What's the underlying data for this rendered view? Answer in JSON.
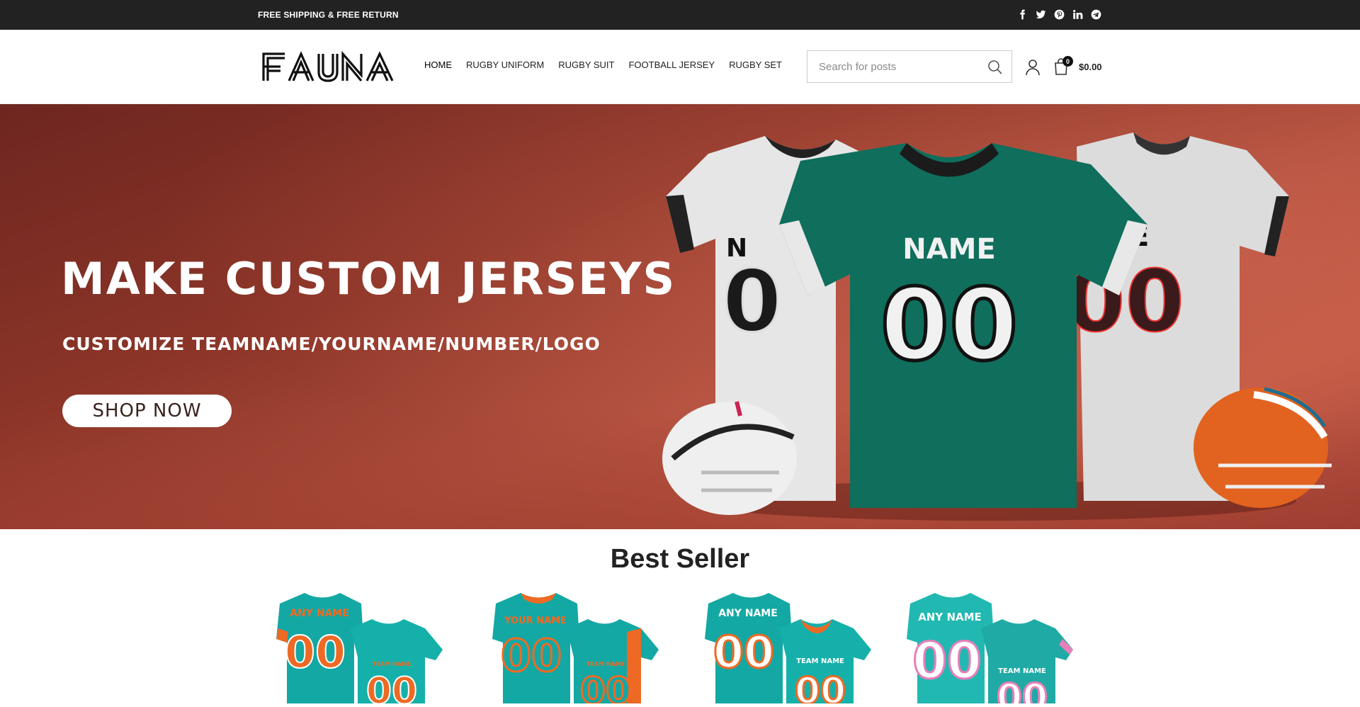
{
  "topbar": {
    "promo": "FREE SHIPPING & FREE RETURN",
    "social_icons": [
      "facebook-icon",
      "twitter-icon",
      "pinterest-icon",
      "linkedin-icon",
      "telegram-icon"
    ]
  },
  "header": {
    "logo_text": "FAUNA",
    "nav": [
      {
        "label": "HOME",
        "active": true
      },
      {
        "label": "RUGBY UNIFORM"
      },
      {
        "label": "RUGBY SUIT"
      },
      {
        "label": "FOOTBALL JERSEY"
      },
      {
        "label": "RUGBY SET"
      }
    ],
    "search": {
      "placeholder": "Search for posts",
      "value": ""
    },
    "cart": {
      "count": "0",
      "total": "$0.00"
    }
  },
  "hero": {
    "title": "MAKE CUSTOM JERSEYS",
    "subtitle": "CUSTOMIZE TEAMNAME/YOURNAME/NUMBER/LOGO",
    "button": "SHOP NOW",
    "jersey_center_name": "NAME",
    "jersey_center_number": "00",
    "jersey_left_number": "0",
    "jersey_left_name": "N",
    "jersey_right_name": "E",
    "jersey_right_number": "00"
  },
  "best_seller": {
    "title": "Best Seller",
    "products": [
      {
        "front_name": "ANY NAME",
        "number": "00",
        "back_label": "TEAM NAME",
        "color": "#13a8a3",
        "accent": "#ee6a24"
      },
      {
        "front_name": "YOUR NAME",
        "number": "00",
        "back_label": "TEAM NAME",
        "color": "#13a8a3",
        "accent": "#ee6a24"
      },
      {
        "front_name": "ANY NAME",
        "number": "00",
        "back_label": "TEAM NAME",
        "color": "#13a8a3",
        "accent": "#ee6a24"
      },
      {
        "front_name": "ANY NAME",
        "number": "00",
        "back_label": "TEAM NAME",
        "color": "#21b8b2",
        "accent": "#e77fb8"
      }
    ]
  },
  "colors": {
    "topbar_bg": "#222222",
    "hero_bg": "#9e4033",
    "jersey_green": "#0f6e5c",
    "jersey_white": "#e9e9e9"
  }
}
